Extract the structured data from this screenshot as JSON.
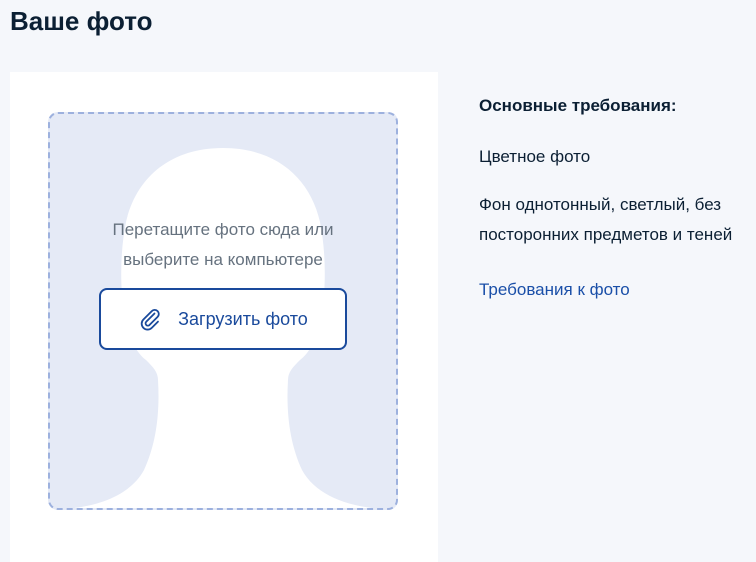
{
  "page": {
    "title": "Ваше фото"
  },
  "upload": {
    "hint_line1": "Перетащите фото сюда или",
    "hint_line2": "выберите на компьютере",
    "button_label": "Загрузить фото",
    "button_icon": "paperclip-icon"
  },
  "requirements": {
    "heading": "Основные требования:",
    "items": [
      "Цветное фото",
      "Фон однотонный, светлый, без посторонних предметов и теней"
    ],
    "link_label": "Требования к фото"
  },
  "colors": {
    "background": "#f5f7fb",
    "card": "#ffffff",
    "dropzone_fill": "#e5eaf6",
    "dropzone_border": "#9db1de",
    "accent": "#1a4a9c",
    "link": "#1a4fa8",
    "text": "#0b1f33",
    "hint_text": "#66727f"
  }
}
